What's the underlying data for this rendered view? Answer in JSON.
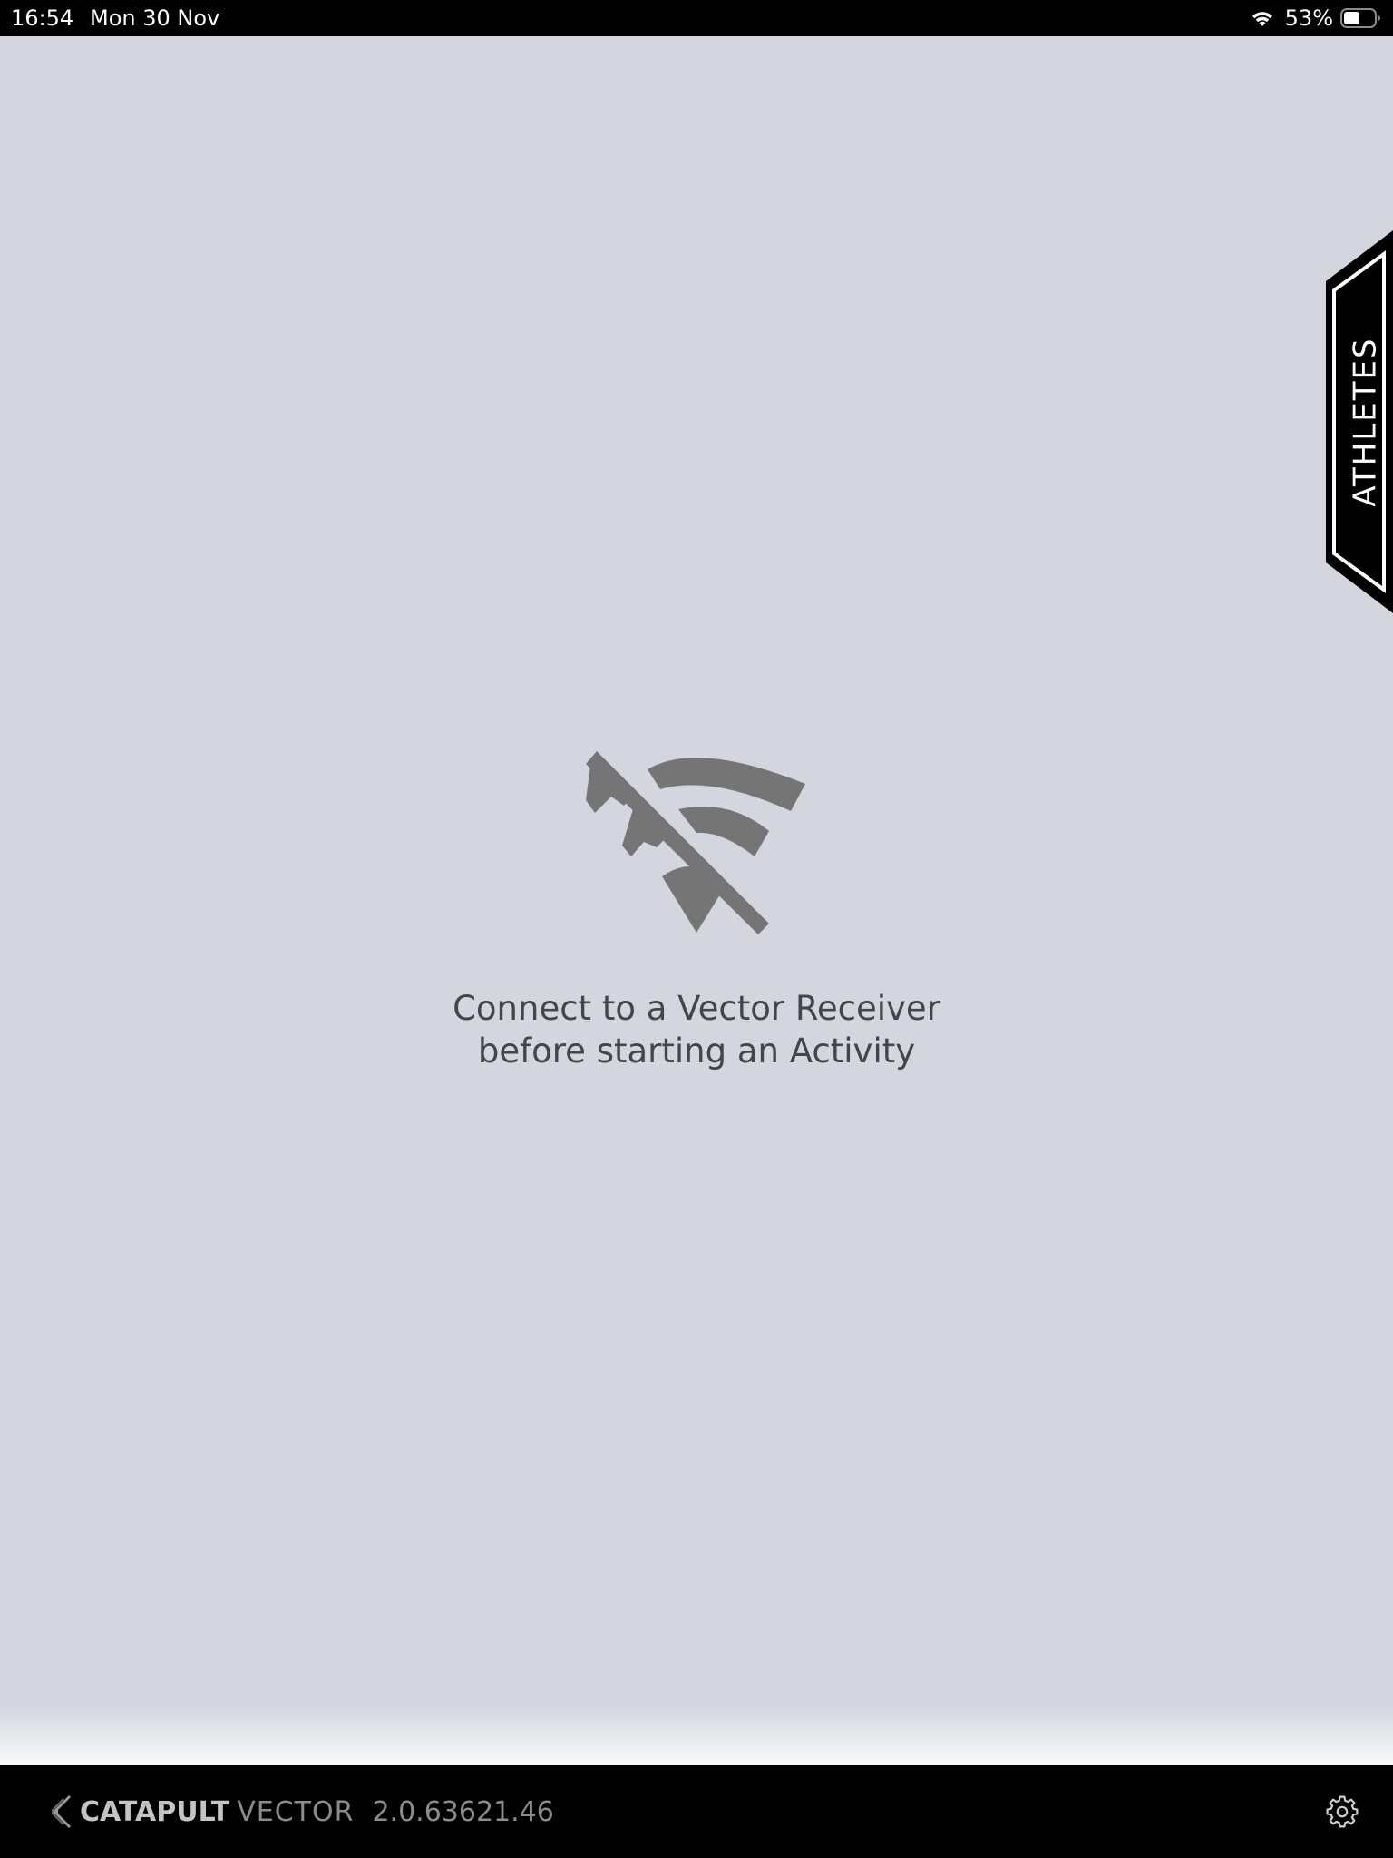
{
  "status_bar": {
    "time": "16:54",
    "date": "Mon 30 Nov",
    "battery_percent": "53%",
    "battery_level": 0.53,
    "wifi_icon": "wifi-icon",
    "battery_icon": "battery-icon"
  },
  "side_tab": {
    "label": "ATHLETES"
  },
  "empty_state": {
    "icon": "wifi-off-icon",
    "message_line1": "Connect to a Vector Receiver",
    "message_line2": "before starting an Activity"
  },
  "footer": {
    "brand_primary": "CATAPULT",
    "brand_secondary": "VECTOR",
    "version": "2.0.63621.46",
    "settings_icon": "gear-icon"
  },
  "colors": {
    "background": "#d3d6de",
    "bars": "#000000",
    "icon_gray": "#757575",
    "message_text": "#444548"
  }
}
